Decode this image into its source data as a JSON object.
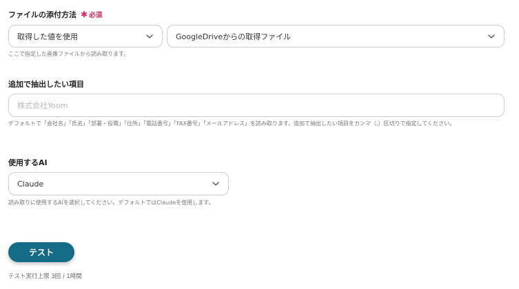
{
  "attach_method": {
    "label": "ファイルの添付方法",
    "required_mark": "✱",
    "required_text": "必須",
    "select_left": "取得した値を使用",
    "select_right": "GoogleDriveからの取得ファイル",
    "hint": "ここで指定した画像ファイルから読み取ります。"
  },
  "extra_fields": {
    "label": "追加で抽出したい項目",
    "placeholder": "株式会社Yoom",
    "hint": "デフォルトで「会社名」「氏名」「部署・役職」「住所」「電話番号」「FAX番号」「メールアドレス」を読み取ります。追加で抽出したい項目をカンマ（,）区切りで指定してください。"
  },
  "ai": {
    "label": "使用するAI",
    "selected": "Claude",
    "hint": "読み取りに使用するAIを選択してください。デフォルトではClaudeを使用します。"
  },
  "test": {
    "button_label": "テスト",
    "limit_text": "テスト実行上限 3回 / 1時間"
  },
  "icons": {
    "chevron": "chevron-down-icon"
  }
}
